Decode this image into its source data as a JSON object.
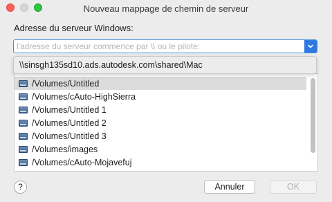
{
  "window": {
    "title": "Nouveau mappage de chemin de serveur"
  },
  "server": {
    "label": "Adresse du serveur Windows:",
    "value": "",
    "placeholder": "l'adresse du serveur commence par \\\\ ou le pilote:"
  },
  "suggestion": {
    "path": "\\\\sinsgh135sd10.ads.autodesk.com\\shared\\Mac"
  },
  "volumes": [
    {
      "label": "/Volumes/Untitled",
      "selected": true
    },
    {
      "label": "/Volumes/cAuto-HighSierra"
    },
    {
      "label": "/Volumes/Untitled 1"
    },
    {
      "label": "/Volumes/Untitled 2"
    },
    {
      "label": "/Volumes/Untitled 3"
    },
    {
      "label": "/Volumes/images"
    },
    {
      "label": "/Volumes/cAuto-Mojavefuj"
    }
  ],
  "buttons": {
    "help": "?",
    "cancel": "Annuler",
    "ok": "OK"
  },
  "colors": {
    "accent": "#2f78e0",
    "focus_ring": "#3f8ed8",
    "selected_row": "#dcdcdc"
  }
}
